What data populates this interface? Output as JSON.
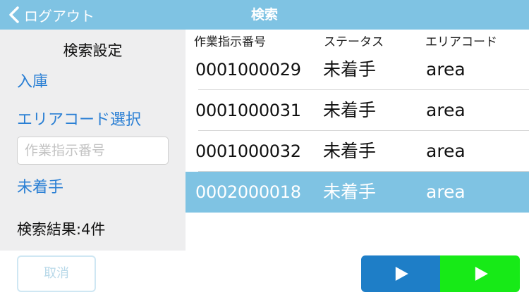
{
  "navbar": {
    "back_label": "ログアウト",
    "title": "検索",
    "color": "#7fc3e3"
  },
  "sidebar": {
    "title": "検索設定",
    "warehouse_link": "入庫",
    "area_link": "エリアコード選択",
    "search_placeholder": "作業指示番号",
    "search_value": "",
    "status_link": "未着手",
    "result_count": "検索結果:4件",
    "cancel_label": "取消"
  },
  "table": {
    "columns": [
      "作業指示番号",
      "ステータス",
      "エリアコード"
    ],
    "rows": [
      {
        "order_no": "0001000029",
        "status": "未着手",
        "area": "area",
        "selected": false
      },
      {
        "order_no": "0001000031",
        "status": "未着手",
        "area": "area",
        "selected": false
      },
      {
        "order_no": "0001000032",
        "status": "未着手",
        "area": "area",
        "selected": false
      },
      {
        "order_no": "0002000018",
        "status": "未着手",
        "area": "area",
        "selected": true
      }
    ]
  },
  "actions": {
    "primary_icon": "play-icon",
    "secondary_icon": "play-icon",
    "primary_color": "#1e7ec7",
    "secondary_color": "#17ea17"
  }
}
